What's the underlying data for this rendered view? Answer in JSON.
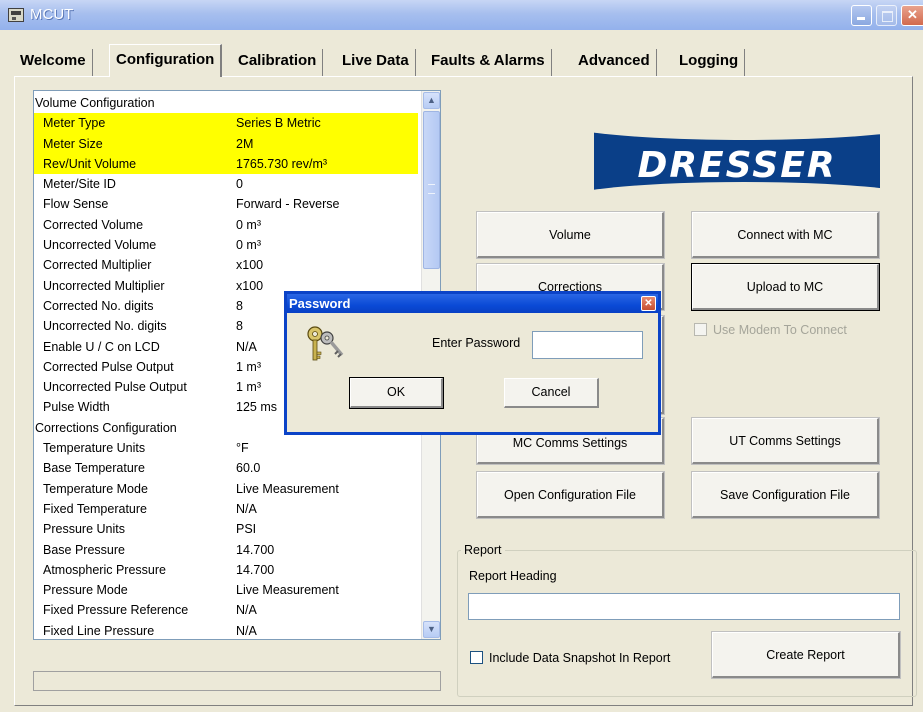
{
  "window": {
    "title": "MCUT"
  },
  "tabs": [
    "Welcome",
    "Configuration",
    "Calibration",
    "Live Data",
    "Faults & Alarms",
    "Advanced",
    "Logging"
  ],
  "active_tab": "Configuration",
  "list": {
    "rows": [
      {
        "key": "Volume Configuration",
        "value": "",
        "section": true,
        "highlight": false
      },
      {
        "key": "Meter Type",
        "value": "Series B Metric",
        "section": false,
        "highlight": true
      },
      {
        "key": "Meter Size",
        "value": "2M",
        "section": false,
        "highlight": true
      },
      {
        "key": "Rev/Unit Volume",
        "value": "1765.730 rev/m³",
        "section": false,
        "highlight": true
      },
      {
        "key": "Meter/Site ID",
        "value": "0",
        "section": false,
        "highlight": false
      },
      {
        "key": "Flow Sense",
        "value": "Forward - Reverse",
        "section": false,
        "highlight": false
      },
      {
        "key": "Corrected Volume",
        "value": "0 m³",
        "section": false,
        "highlight": false
      },
      {
        "key": "Uncorrected Volume",
        "value": "0 m³",
        "section": false,
        "highlight": false
      },
      {
        "key": "Corrected Multiplier",
        "value": "x100",
        "section": false,
        "highlight": false
      },
      {
        "key": "Uncorrected Multiplier",
        "value": "x100",
        "section": false,
        "highlight": false
      },
      {
        "key": "Corrected No. digits",
        "value": "8",
        "section": false,
        "highlight": false
      },
      {
        "key": "Uncorrected No. digits",
        "value": "8",
        "section": false,
        "highlight": false
      },
      {
        "key": "Enable U / C on LCD",
        "value": "N/A",
        "section": false,
        "highlight": false
      },
      {
        "key": "Corrected Pulse Output",
        "value": "1 m³",
        "section": false,
        "highlight": false
      },
      {
        "key": "Uncorrected Pulse Output",
        "value": "1 m³",
        "section": false,
        "highlight": false
      },
      {
        "key": "Pulse Width",
        "value": "125 ms",
        "section": false,
        "highlight": false
      },
      {
        "key": "Corrections Configuration",
        "value": "",
        "section": true,
        "highlight": false
      },
      {
        "key": "Temperature Units",
        "value": "°F",
        "section": false,
        "highlight": false
      },
      {
        "key": "Base Temperature",
        "value": "60.0",
        "section": false,
        "highlight": false
      },
      {
        "key": "Temperature Mode",
        "value": "Live Measurement",
        "section": false,
        "highlight": false
      },
      {
        "key": "Fixed Temperature",
        "value": "N/A",
        "section": false,
        "highlight": false
      },
      {
        "key": "Pressure Units",
        "value": "PSI",
        "section": false,
        "highlight": false
      },
      {
        "key": "Base Pressure",
        "value": "14.700",
        "section": false,
        "highlight": false
      },
      {
        "key": "Atmospheric Pressure",
        "value": "14.700",
        "section": false,
        "highlight": false
      },
      {
        "key": "Pressure Mode",
        "value": "Live Measurement",
        "section": false,
        "highlight": false
      },
      {
        "key": "Fixed Pressure Reference",
        "value": "N/A",
        "section": false,
        "highlight": false
      },
      {
        "key": "Fixed Line Pressure",
        "value": "N/A",
        "section": false,
        "highlight": false
      }
    ]
  },
  "logo": {
    "text": "DRESSER"
  },
  "buttons": {
    "volume": "Volume",
    "connect": "Connect with MC",
    "corrections": "Corrections",
    "upload": "Upload to MC",
    "mc_comms": "MC Comms Settings",
    "ut_comms": "UT Comms Settings",
    "open_config": "Open Configuration File",
    "save_config": "Save Configuration File",
    "create_report": "Create Report"
  },
  "modem": {
    "label": "Use Modem To Connect",
    "checked": false,
    "enabled": false
  },
  "report": {
    "group_label": "Report",
    "heading_label": "Report Heading",
    "heading_value": "",
    "snapshot_label": "Include Data Snapshot In Report",
    "snapshot_checked": false
  },
  "dialog": {
    "title": "Password",
    "prompt": "Enter Password",
    "password_value": "",
    "ok": "OK",
    "cancel": "Cancel"
  },
  "colors": {
    "highlight": "#ffff00",
    "logo_blue": "#0a3f88",
    "dialog_title": "#0a4ad6"
  }
}
